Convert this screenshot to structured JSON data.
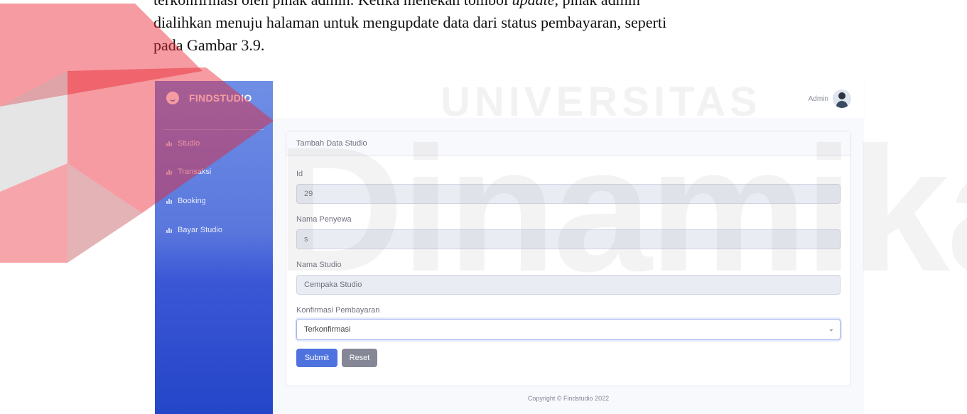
{
  "paper": {
    "line1_pre": "terkonfirmasi oleh pihak admin. Ketika menekan tombol ",
    "line1_em": "update",
    "line1_post": ", pihak admin",
    "line2": "dialihkan menuju halaman untuk mengupdate data dari status pembayaran, seperti",
    "line3": "pada Gambar 3.9."
  },
  "watermark": {
    "top_text": "UNIVERSITAS",
    "main_text": "Dinamika"
  },
  "sidebar": {
    "brand": "FINDSTUDIO",
    "items": [
      {
        "label": "Studio"
      },
      {
        "label": "Transaksi"
      },
      {
        "label": "Booking"
      },
      {
        "label": "Bayar Studio"
      }
    ]
  },
  "topbar": {
    "user_label": "Admin"
  },
  "form": {
    "title": "Tambah Data Studio",
    "fields": [
      {
        "label": "Id",
        "value": "29"
      },
      {
        "label": "Nama Penyewa",
        "value": "s"
      },
      {
        "label": "Nama Studio",
        "value": "Cempaka Studio"
      }
    ],
    "select": {
      "label": "Konfirmasi Pembayaran",
      "value": "Terkonfirmasi"
    },
    "submit_label": "Submit",
    "reset_label": "Reset"
  },
  "footer": {
    "text": "Copyright © Findstudio 2022"
  },
  "colors": {
    "sidebar_top": "#6f8fe6",
    "sidebar_bottom": "#2446c8",
    "primary": "#4e73df",
    "secondary": "#858796",
    "watermark_red": "#e8212e"
  }
}
